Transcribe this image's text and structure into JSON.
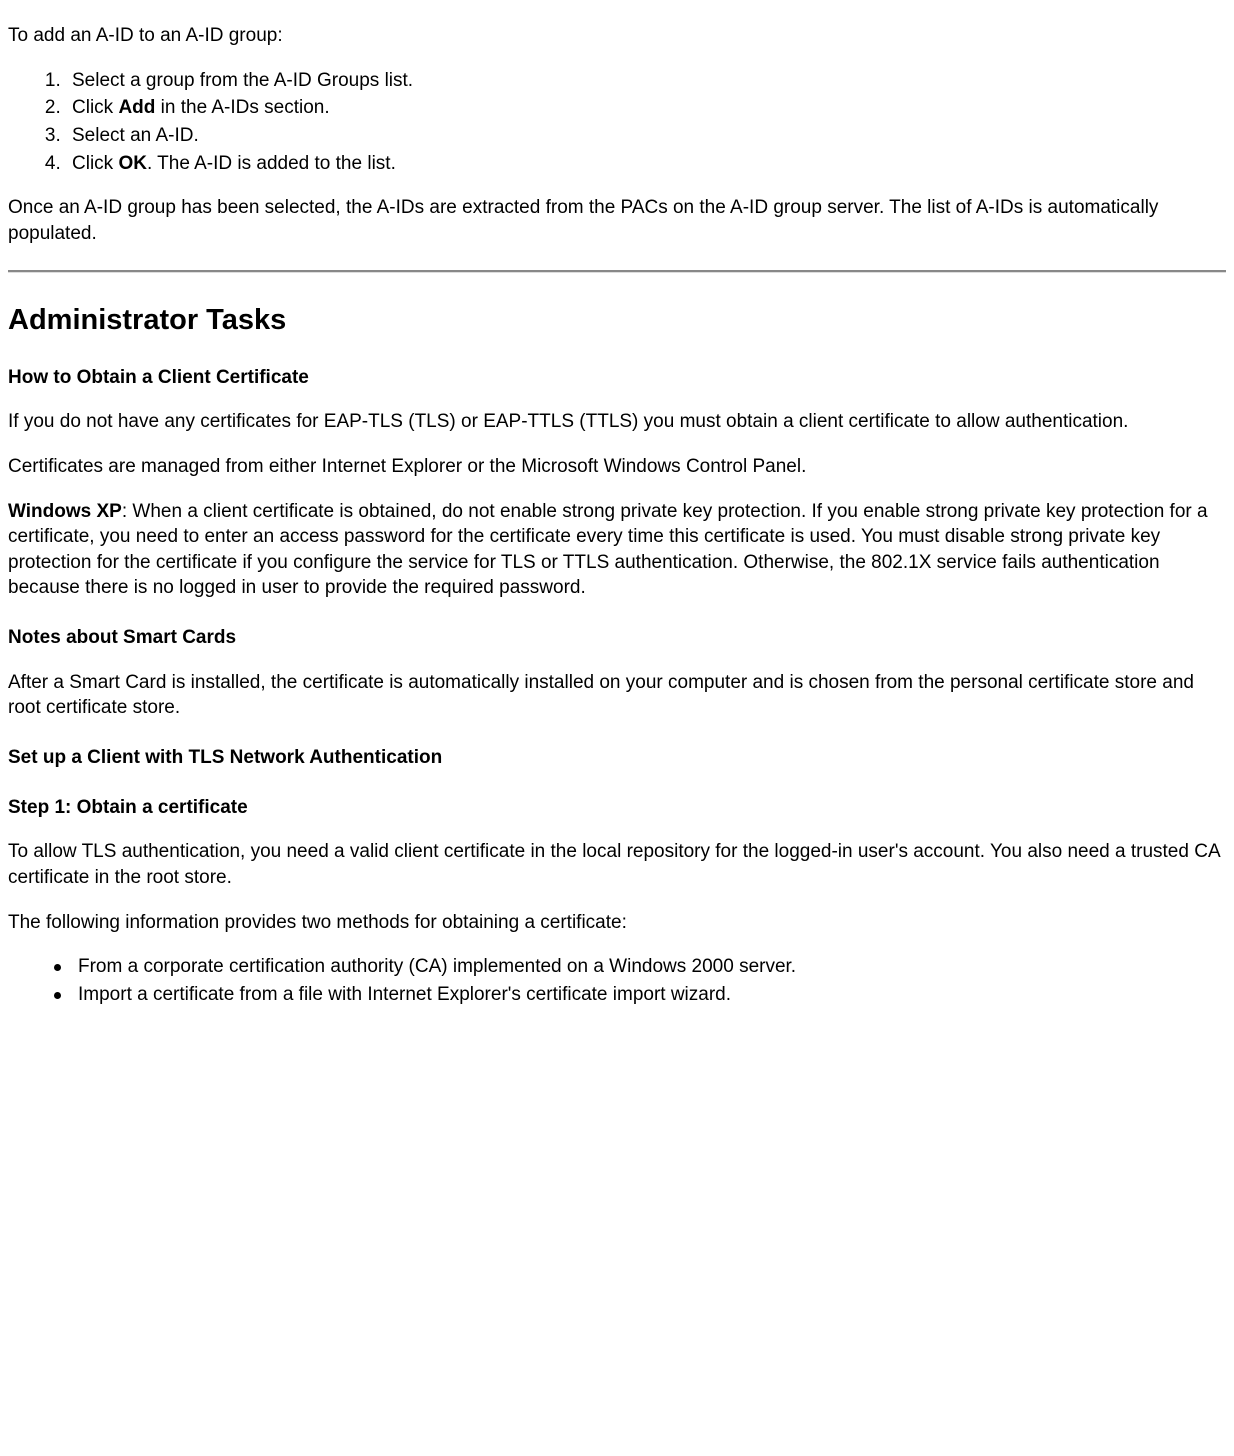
{
  "intro": {
    "lead": "To add an A-ID to an A-ID group:",
    "steps": {
      "s1": "Select a group from the A-ID Groups list.",
      "s2a": "Click ",
      "s2b": "Add",
      "s2c": " in the A-IDs section.",
      "s3": "Select an A-ID.",
      "s4a": "Click ",
      "s4b": "OK",
      "s4c": ". The A-ID is added to the list."
    },
    "after": "Once an A-ID group has been selected, the A-IDs are extracted from the PACs on the A-ID group server. The list of A-IDs is automatically populated."
  },
  "admin": {
    "title": "Administrator Tasks",
    "obtain": {
      "heading": "How to Obtain a Client Certificate",
      "p1": "If you do not have any certificates for EAP-TLS (TLS) or EAP-TTLS (TTLS) you must obtain a client certificate to allow authentication.",
      "p2": "Certificates are managed from either Internet Explorer or the Microsoft Windows Control Panel.",
      "xp_label": "Windows XP",
      "xp_text": ": When a client certificate is obtained, do not enable strong private key protection. If you enable strong private key protection for a certificate, you need to enter an access password for the certificate every time this certificate is used. You must disable strong private key protection for the certificate if you configure the service for TLS or TTLS authentication. Otherwise, the 802.1X service fails authentication because there is no logged in user to provide the required password."
    },
    "smart": {
      "heading": "Notes about Smart Cards",
      "p1": "After a Smart Card is installed, the certificate is automatically installed on your computer and is chosen from the personal certificate store and root certificate store."
    },
    "tls": {
      "heading": "Set up a Client with TLS Network Authentication",
      "step1_heading": "Step 1: Obtain a certificate",
      "p1": "To allow TLS authentication, you need a valid client certificate in the local repository for the logged-in user's account. You also need a trusted CA certificate in the root store.",
      "p2": "The following information provides two methods for obtaining a certificate:",
      "bullets": {
        "b1": "From a corporate certification authority (CA) implemented on a Windows 2000 server.",
        "b2": "Import a certificate from a file with Internet Explorer's certificate import wizard."
      }
    }
  }
}
